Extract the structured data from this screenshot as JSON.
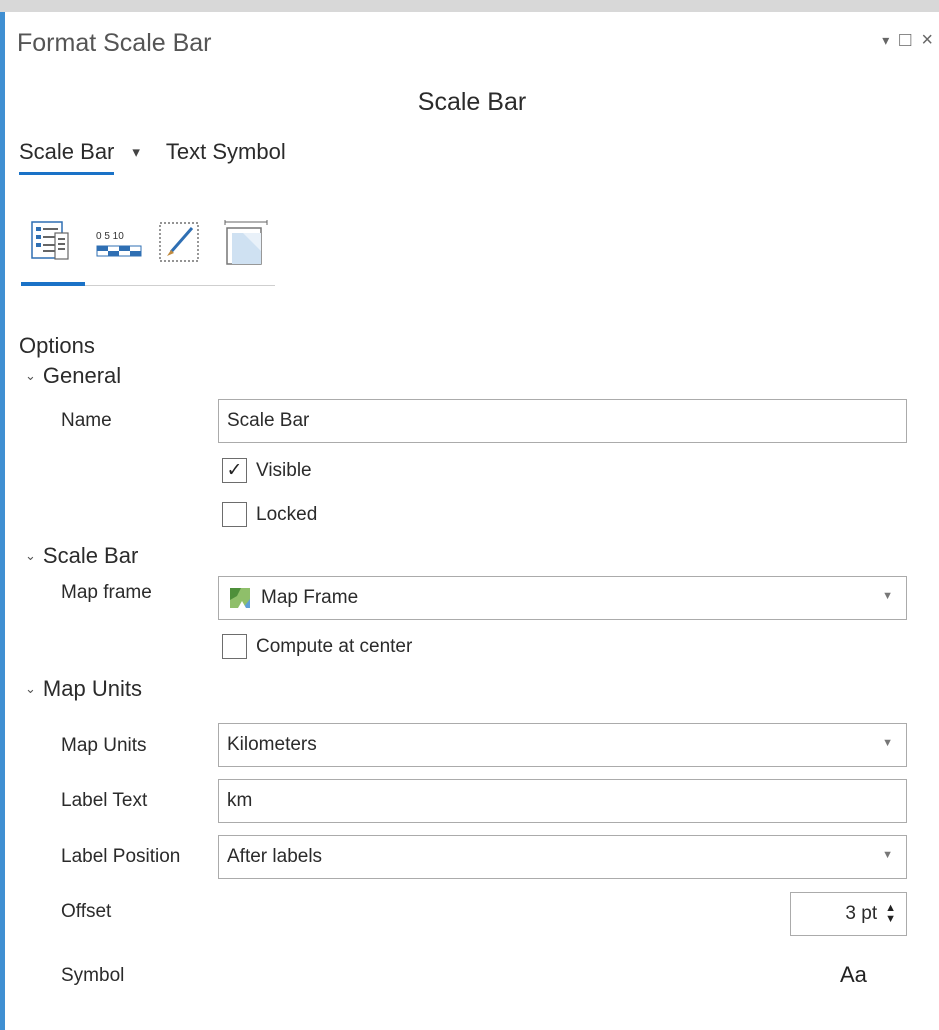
{
  "pane": {
    "title": "Format Scale Bar",
    "pin_glyph": "▾",
    "maximize_glyph": "□",
    "close_glyph": "×"
  },
  "element_title": "Scale Bar",
  "tabs": [
    {
      "label": "Scale Bar",
      "active": true
    },
    {
      "label": "Text Symbol",
      "active": false
    }
  ],
  "tab_dropdown_glyph": "▾",
  "icon_tabs": [
    {
      "name": "options-icon",
      "active": true
    },
    {
      "name": "scale-bar-properties-icon",
      "active": false
    },
    {
      "name": "symbology-brush-icon",
      "active": false
    },
    {
      "name": "display-frame-icon",
      "active": false
    }
  ],
  "icon_tab_texts": {
    "scale_numbers": "0 5 10"
  },
  "section_title": "Options",
  "chevron_glyph": "⌄",
  "general": {
    "heading": "General",
    "name_label": "Name",
    "name_value": "Scale Bar",
    "visible_label": "Visible",
    "visible_checked": true,
    "locked_label": "Locked",
    "locked_checked": false
  },
  "scale_bar": {
    "heading": "Scale Bar",
    "map_frame_label": "Map frame",
    "map_frame_value": "Map Frame",
    "compute_center_label": "Compute at center",
    "compute_center_checked": false
  },
  "map_units": {
    "heading": "Map Units",
    "units_label": "Map Units",
    "units_value": "Kilometers",
    "label_text_label": "Label Text",
    "label_text_value": "km",
    "label_position_label": "Label Position",
    "label_position_value": "After labels",
    "offset_label": "Offset",
    "offset_value": "3 pt",
    "symbol_label": "Symbol",
    "symbol_preview": "Aa"
  },
  "check_glyph": "✓",
  "dropdown_glyph": "▼",
  "spin_up_glyph": "▲",
  "spin_down_glyph": "▼",
  "colors": {
    "accent": "#1a72c7",
    "border": "#ababab",
    "text": "#2b2b2b"
  }
}
